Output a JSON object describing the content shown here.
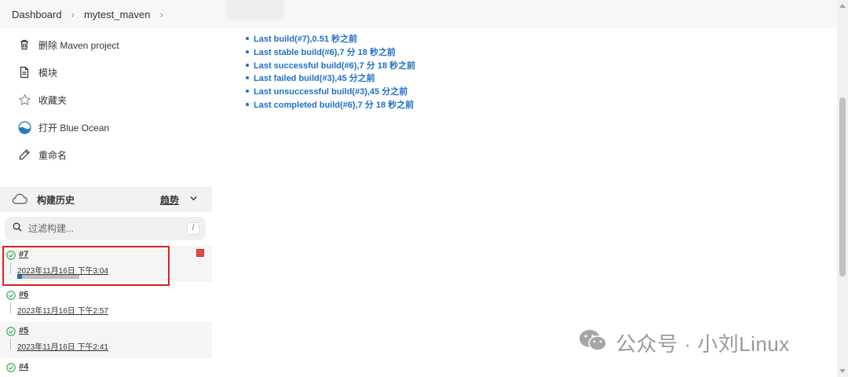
{
  "breadcrumb": {
    "items": [
      "Dashboard",
      "mytest_maven"
    ]
  },
  "sidebar": {
    "tasks": [
      {
        "label": "删除 Maven project",
        "icon": "trash-icon"
      },
      {
        "label": "模块",
        "icon": "document-icon"
      },
      {
        "label": "收藏夹",
        "icon": "star-icon"
      },
      {
        "label": "打开 Blue Ocean",
        "icon": "blue-ocean-icon"
      },
      {
        "label": "重命名",
        "icon": "pencil-icon"
      }
    ],
    "history": {
      "title": "构建历史",
      "trend_label": "趋势",
      "filter_placeholder": "过滤构建...",
      "filter_shortcut": "/",
      "builds": [
        {
          "number": "#7",
          "time": "2023年11月16日 下午3:04",
          "status": "success",
          "in_progress": true,
          "progress": 0.08
        },
        {
          "number": "#6",
          "time": "2023年11月16日 下午2:57",
          "status": "success"
        },
        {
          "number": "#5",
          "time": "2023年11月16日 下午2:41",
          "status": "success"
        },
        {
          "number": "#4",
          "time": "",
          "status": "success"
        }
      ]
    }
  },
  "main": {
    "permalinks": [
      "Last build(#7),0.51 秒之前",
      "Last stable build(#6),7 分 18 秒之前",
      "Last successful build(#6),7 分 18 秒之前",
      "Last failed build(#3),45 分之前",
      "Last unsuccessful build(#3),45 分之前",
      "Last completed build(#6),7 分 18 秒之前"
    ]
  },
  "watermark": {
    "text": "公众号 · 小刘Linux"
  },
  "colors": {
    "link": "#1f6fc5",
    "success": "#2ea44f",
    "highlight": "#e02020",
    "progress": "#1f6fc5"
  }
}
